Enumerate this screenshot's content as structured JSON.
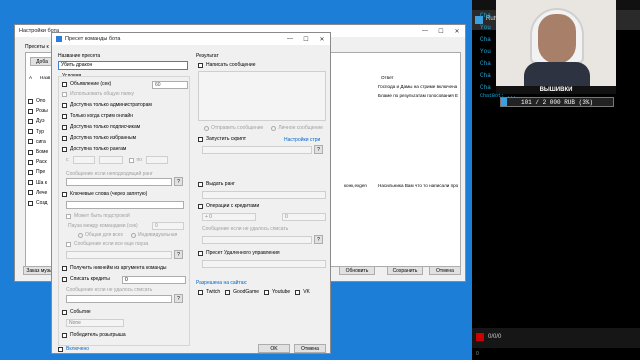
{
  "bg_window": {
    "title": "Настройки бота",
    "tab_label": "Пресеты к",
    "column_a": "А",
    "column_name": "Назв",
    "column_answer": "Ответ",
    "left_rows": [
      "Опо",
      "Розы",
      "Дуэ",
      "Тур",
      "сига",
      "Боме",
      "Раск",
      "Пре",
      "Ша к",
      "Лече",
      "Созд"
    ],
    "answer_rows": [
      "Господа и Дамы на стриме включена",
      "Бламе по результатам голосования E"
    ],
    "mid_row_cmd": "конк,exgen",
    "mid_row_answer": "Насильника Вам что то написали про",
    "bottom_left_btn": "Заказ музыки",
    "btn_update": "Обновить",
    "btn_save": "Сохранить",
    "btn_close": "Отмена",
    "add_btn": "Доба"
  },
  "dialog": {
    "title": "Пресет команды бота",
    "name_label": "Название пресета",
    "name_value": "Убить дракон",
    "condition_label": "Условия",
    "result_label": "Результат",
    "chk_mention": "Объявление (сек)",
    "mention_value": "60",
    "chk_search": "Использовать общую папку",
    "chk_admin": "Доступна только администраторам",
    "chk_online": "Только когда стрим онлайн",
    "chk_subs": "Доступна только подписчикам",
    "chk_chosen": "Доступна только избранным",
    "chk_rank": "Доступна только рангам",
    "rank_msg": "Сообщение если неподходящий ранг",
    "chk_keywords": "Ключевые слова (через запятую)",
    "chk_by_sub": "Может быть подстрокой",
    "delay_label": "Пауза между командами (сек)",
    "delay_value": "0",
    "radio_all": "Общая для всех",
    "radio_ind": "Индивидуальная",
    "pause_msg": "Сообщение если все еще пауза",
    "chk_arg": "Получить никнейм из аргумента команды",
    "chk_credits": "Списать кредиты",
    "credits_value": "0",
    "credits_msg": "Сообщение если не удалось списать",
    "chk_event": "Событие",
    "event_value": "None",
    "chk_winner": "Победитель розыгрыша",
    "enabled_label": "Включено",
    "chk_write_msg": "Написать сообщение",
    "send_msg": "Отправить сообщение",
    "private_msg": "Личное сообщение",
    "chk_run_script": "Запустить скрипт",
    "script_settings": "Настройки стри",
    "chk_give_rank": "Выдать ранг",
    "chk_credit_ops": "Операции с кредитами",
    "credit_op_value": "+ 0",
    "credit_op_num": "0",
    "credit_op_msg": "Сообщение если не удалось списать",
    "chk_remote": "Пресет Удаленного управления",
    "platforms_label": "Разрешена на сайтах:",
    "platforms": [
      "Twitch",
      "GoodGame",
      "Youtube",
      "VK"
    ],
    "ok_label": "OK",
    "cancel_label": "Отмена",
    "q": "?",
    "range_from": "с",
    "range_to": "по"
  },
  "stream": {
    "title": "Rutv",
    "chat_names": [
      "Cha",
      "You",
      "Cha",
      "You",
      "Cha",
      "Cha",
      "Cha"
    ],
    "chat_tail": "ChatBot: ...",
    "banner": "ВЫШИВКИ",
    "progress_text": "101 / 2 000 RUB (3%)",
    "progress": 0.05,
    "footer_counter": "0/0/0",
    "bottom_status": "0"
  }
}
